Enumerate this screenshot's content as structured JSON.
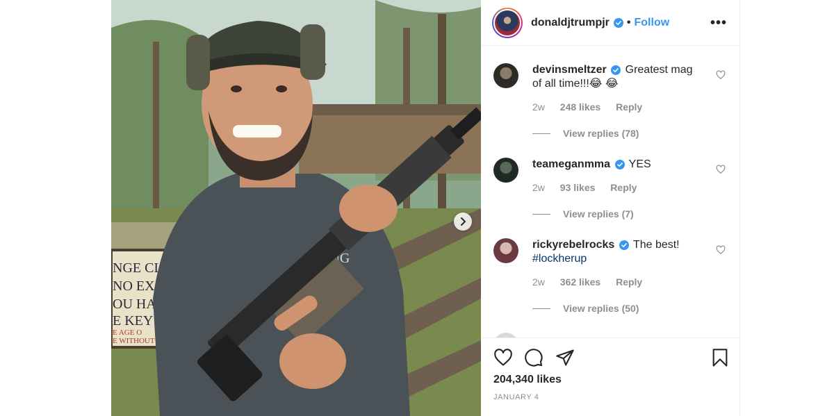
{
  "post": {
    "username": "donaldjtrumpjr",
    "follow_label": "Follow",
    "separator": "•"
  },
  "comments": [
    {
      "user": "devinsmeltzer",
      "text": "Greatest mag of all time!!!😂 😂",
      "age": "2w",
      "likes": "248 likes",
      "reply_label": "Reply",
      "view_replies": "View replies (78)"
    },
    {
      "user": "teameganmma",
      "text": "YES",
      "age": "2w",
      "likes": "93 likes",
      "reply_label": "Reply",
      "view_replies": "View replies (7)"
    },
    {
      "user": "rickyrebelrocks",
      "text": "The best!",
      "hashtag": "#lockherup",
      "age": "2w",
      "likes": "362 likes",
      "reply_label": "Reply",
      "view_replies": "View replies (50)"
    }
  ],
  "footer": {
    "likes_total": "204,340 likes",
    "date": "JANUARY 4"
  },
  "photo_sign_text": [
    "NGE CLO",
    "NO EXC",
    "OU HAVE",
    "E KEY A",
    "E AGE O",
    "E WITHOUT"
  ],
  "shirt_text": "ONG",
  "icons": [
    "heart-icon",
    "comment-icon",
    "share-icon",
    "bookmark-icon",
    "more-icon",
    "verified-icon",
    "chevron-right-icon"
  ],
  "colors": {
    "accent": "#3897f0",
    "text": "#262626",
    "muted": "#8e8e8e",
    "verified": "#3897f0"
  }
}
